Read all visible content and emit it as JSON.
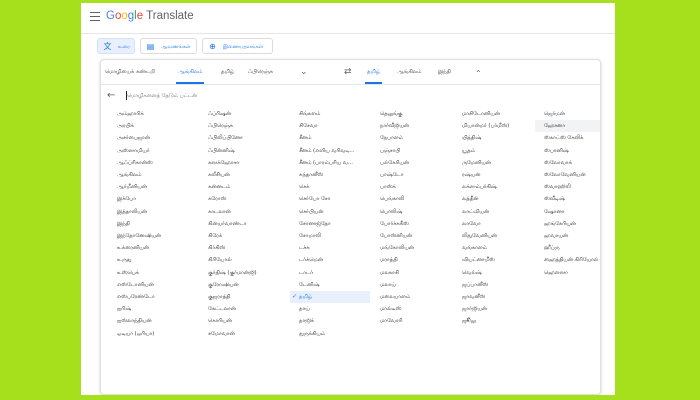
{
  "app": {
    "logo_parts": [
      "G",
      "o",
      "o",
      "g",
      "l",
      "e"
    ],
    "title": "Translate"
  },
  "modes": [
    {
      "label": "உரை",
      "icon": "translate-icon"
    },
    {
      "label": "ஆவணங்கள்",
      "icon": "document-icon"
    },
    {
      "label": "இணையதளங்கள்",
      "icon": "globe-icon"
    }
  ],
  "source_tabs": [
    "மொழியைக் கண்டறி",
    "ஆங்கிலம்",
    "தமிழ்",
    "ஃபிரெஞ்சு"
  ],
  "target_tabs": [
    "தமிழ்",
    "ஆங்கிலம்",
    "இந்தி"
  ],
  "search": {
    "placeholder": "மொழிகளைத் தேடும் பட்டன்"
  },
  "selected_language": "தமிழ்",
  "highlighted_language": "ஹேசனா",
  "columns": [
    [
      "அம்ஹாரிக்",
      "அரபிக்",
      "அசர்பைஜான்",
      "அஸ்ஸாமியர்",
      "ஆஃப்ரிகான்ஸ்",
      "ஆங்கிலம்",
      "ஆர்மீனியன்",
      "இக்போ",
      "இத்தாலியன்",
      "இந்தி",
      "இந்தோனேஷியன்",
      "உக்ரைனியன்",
      "உருது",
      "உஸ்பெக்",
      "எஸ்டோனியன்",
      "எஸ்பரேண்டோ",
      "ஐரிஷ்",
      "ஐஸ்லாந்தியன்",
      "ஒடியா (ஒரியா)"
    ],
    [
      "ஃப்ரிஷன்",
      "ஃபிரெஞ்சு",
      "ஃபிலிப்பினோ",
      "ஃபின்னிஷ்",
      "கஸக்ஹோசா",
      "கலீசியன்",
      "கன்னடம்",
      "கரோஸ்",
      "காடலான்",
      "கின்யர்வாண்டா",
      "கிரேக்",
      "கிர்கிஸ்",
      "கிரியோல்",
      "குர்திஷ் (குர்மான்ஜி)",
      "குரோஷியன்",
      "குஜராத்தி",
      "கேட்டலான்",
      "கொரியன்",
      "சமோவான்"
    ],
    [
      "சிங்களம்",
      "சிசேவா",
      "சீனம்",
      "சீனம் (எளிய வரிவடி...",
      "சீனம் (பாரம்பரிய வ...",
      "சுந்தானீஸ்",
      "செக்",
      "செர்போ சோ",
      "செர்பியன்",
      "சோனாஜ்தோ",
      "சோமாலி",
      "டச்சு",
      "டர்க்மென்",
      "டாடர்",
      "டேனிஷ்",
      "தமிழ்",
      "தாய்",
      "தாஜிக்",
      "துருக்கியம்"
    ],
    [
      "தெலுங்கு",
      "நார்வீஜியன்",
      "நேபாளம்",
      "பஞ்சாபி",
      "பல்கேரியன்",
      "பாஷ்டோ",
      "பாஸ்க்",
      "பெங்காலி",
      "பொலிஷ்",
      "போர்ச்சுகீஸ்",
      "போஸ்னியன்",
      "மங்கோலியன்",
      "மராத்தி",
      "மலகாசி",
      "மலாய்",
      "மலையாளம்",
      "மால்டீஸ்",
      "மாவோரி"
    ],
    [
      "மாசிடோனியன்",
      "மியான்மர் (பர்மீஸ்)",
      "யித்திஷ்",
      "யூதம்",
      "ருமேனியன்",
      "ரஷ்யன்",
      "லக்ஸம்பர்கிஷ்",
      "லத்தீன்",
      "லாட்வியன்",
      "லாவோ",
      "லிதுவேனியன்",
      "வங்காளம்",
      "வியட்னாமீஸ்",
      "வெல்ஷ்",
      "ஜப்பானீஸ்",
      "ஜாவனீஸ்",
      "ஜார்ஜியன்",
      "ஜூலு"
    ],
    [
      "ஜெர்மன்",
      "ஹேசனா",
      "ஸ்காட்ஸ் கேலிக்",
      "ஸ்பானிஷ்",
      "ஸ்லோவாக்",
      "ஸ்லோவேனியன்",
      "ஸ்வாஹிலி",
      "ஸ்வீடிஷ்",
      "ஷோனா",
      "ஹங்கேரியன்",
      "ஹவாயன்",
      "ஹீப்ரு",
      "ஹைத்தியன் கிரியோல்",
      "ஹௌஸா"
    ]
  ]
}
